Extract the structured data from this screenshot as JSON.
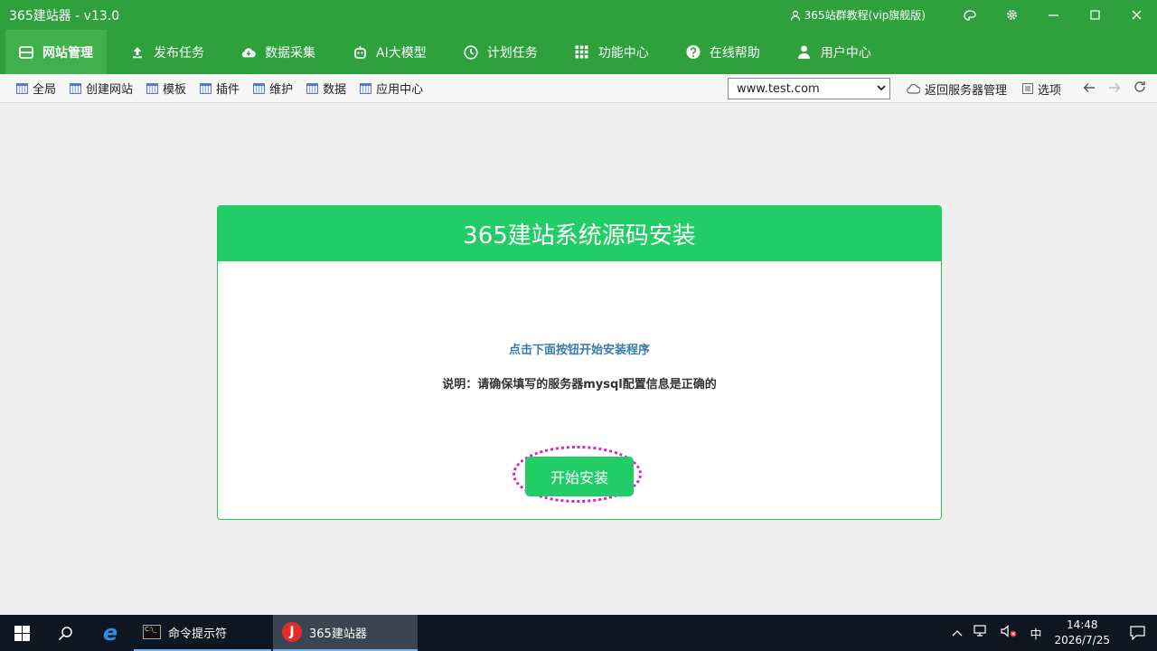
{
  "window": {
    "title": "365建站器 - v13.0",
    "tutorial_label": "365站群教程(vip旗舰版)",
    "controls": [
      "palette-icon",
      "gear-icon",
      "minimize-icon",
      "maximize-icon",
      "close-icon"
    ]
  },
  "main_nav": [
    {
      "label": "网站管理",
      "icon": "window-icon",
      "active": true
    },
    {
      "label": "发布任务",
      "icon": "upload-icon"
    },
    {
      "label": "数据采集",
      "icon": "cloud-download-icon"
    },
    {
      "label": "AI大模型",
      "icon": "robot-icon"
    },
    {
      "label": "计划任务",
      "icon": "clock-icon"
    },
    {
      "label": "功能中心",
      "icon": "grid-icon"
    },
    {
      "label": "在线帮助",
      "icon": "help-icon"
    },
    {
      "label": "用户中心",
      "icon": "user-icon"
    }
  ],
  "toolbar": {
    "items": [
      "全局",
      "创建网站",
      "模板",
      "插件",
      "维护",
      "数据",
      "应用中心"
    ],
    "site_select": "www.test.com",
    "back_server_label": "返回服务器管理",
    "options_label": "选项"
  },
  "install": {
    "title": "365建站系统源码安装",
    "hint": "点击下面按钮开始安装程序",
    "description": "说明：请确保填写的服务器mysql配置信息是正确的",
    "button_label": "开始安装"
  },
  "taskbar": {
    "apps": [
      {
        "label": "命令提示符"
      },
      {
        "label": "365建站器"
      }
    ],
    "ime": "中",
    "time": "14:48",
    "date": "2026/7/25"
  },
  "colors": {
    "title_bar": "#2ea03c",
    "accent_green": "#22cc66",
    "highlight_ring": "#d020d0"
  }
}
